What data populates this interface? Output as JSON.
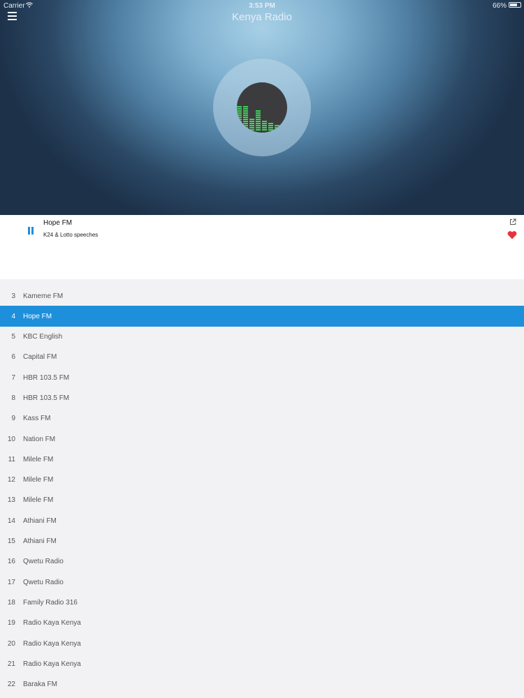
{
  "status_bar": {
    "carrier": "Carrier",
    "time": "3:53 PM",
    "battery": "66%"
  },
  "header": {
    "title": "Kenya Radio"
  },
  "player": {
    "title": "Hope FM",
    "subtitle": "K24 & Lotto speeches",
    "accent_color": "#1e8fdb",
    "favorite_color": "#e8323c",
    "icons": {
      "play_state": "pause-icon",
      "share": "share-icon",
      "favorite": "heart-icon"
    }
  },
  "stations": [
    {
      "num": "3",
      "name": "Kameme FM"
    },
    {
      "num": "4",
      "name": "Hope FM",
      "active": true
    },
    {
      "num": "5",
      "name": "KBC English"
    },
    {
      "num": "6",
      "name": "Capital FM"
    },
    {
      "num": "7",
      "name": "HBR 103.5 FM"
    },
    {
      "num": "8",
      "name": "HBR 103.5 FM"
    },
    {
      "num": "9",
      "name": "Kass FM"
    },
    {
      "num": "10",
      "name": "Nation FM"
    },
    {
      "num": "11",
      "name": "Milele FM"
    },
    {
      "num": "12",
      "name": "Milele FM"
    },
    {
      "num": "13",
      "name": "Milele FM"
    },
    {
      "num": "14",
      "name": "Athiani FM"
    },
    {
      "num": "15",
      "name": "Athiani FM"
    },
    {
      "num": "16",
      "name": "Qwetu Radio"
    },
    {
      "num": "17",
      "name": "Qwetu Radio"
    },
    {
      "num": "18",
      "name": "Family Radio 316"
    },
    {
      "num": "19",
      "name": "Radio Kaya Kenya"
    },
    {
      "num": "20",
      "name": "Radio Kaya Kenya"
    },
    {
      "num": "21",
      "name": "Radio Kaya Kenya"
    },
    {
      "num": "22",
      "name": "Baraka FM"
    }
  ]
}
